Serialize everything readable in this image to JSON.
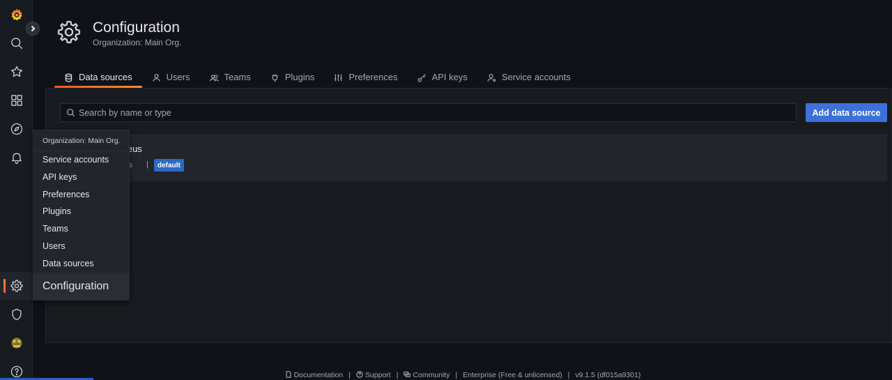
{
  "page": {
    "title": "Configuration",
    "subtitle": "Organization: Main Org."
  },
  "tabs": [
    {
      "label": "Data sources",
      "icon": "database-icon",
      "active": true
    },
    {
      "label": "Users",
      "icon": "user-icon"
    },
    {
      "label": "Teams",
      "icon": "users-icon"
    },
    {
      "label": "Plugins",
      "icon": "plug-icon"
    },
    {
      "label": "Preferences",
      "icon": "sliders-icon"
    },
    {
      "label": "API keys",
      "icon": "key-icon"
    },
    {
      "label": "Service accounts",
      "icon": "user-cog-icon"
    }
  ],
  "search": {
    "placeholder": "Search by name or type",
    "value": ""
  },
  "add_button": {
    "label": "Add data source"
  },
  "datasource": {
    "name": "theus",
    "type": "eus",
    "separator": "|",
    "badge": "default"
  },
  "menu": {
    "header": "Organization: Main Org.",
    "items": [
      "Service accounts",
      "API keys",
      "Preferences",
      "Plugins",
      "Teams",
      "Users",
      "Data sources"
    ],
    "title": "Configuration"
  },
  "sidebar": {
    "items": [
      "grafana-logo-icon",
      "search-icon",
      "star-icon",
      "dashboards-icon",
      "explore-icon",
      "alert-bell-icon",
      "gear-icon",
      "shield-icon",
      "avatar",
      "help-icon"
    ]
  },
  "footer": {
    "documentation": "Documentation",
    "support": "Support",
    "community": "Community",
    "edition": "Enterprise (Free & unlicensed)",
    "version": "v9.1.5 (df015a9301)",
    "separator": "|"
  },
  "colors": {
    "accent": "#f05a28",
    "primary_button": "#3d71d9",
    "badge": "#2a6bc4"
  }
}
